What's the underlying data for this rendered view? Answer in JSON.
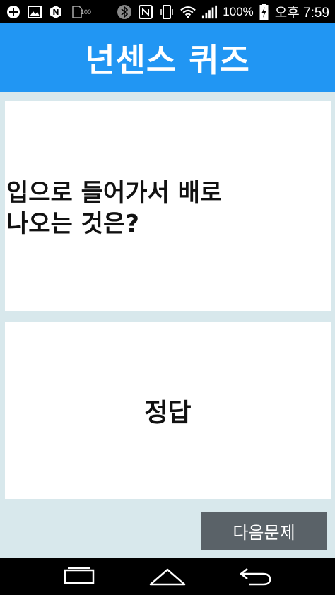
{
  "status_bar": {
    "battery_percent": "100%",
    "time": "오후 7:59",
    "small_badge": "100",
    "icons": [
      "add-icon",
      "image-icon",
      "n-circle-icon",
      "sd-icon",
      "bluetooth-icon",
      "nfc-icon",
      "vibrate-icon",
      "wifi-icon",
      "signal-icon",
      "battery-charging-icon"
    ]
  },
  "app_bar": {
    "title": "넌센스 퀴즈",
    "color": "#2196f3"
  },
  "quiz": {
    "question_line1": "입으로 들어가서 배로",
    "question_line2": "나오는 것은?",
    "answer_label": "정답"
  },
  "actions": {
    "next_label": "다음문제"
  },
  "nav_bar": {
    "icons": [
      "recent-apps-icon",
      "home-icon",
      "back-icon"
    ]
  }
}
